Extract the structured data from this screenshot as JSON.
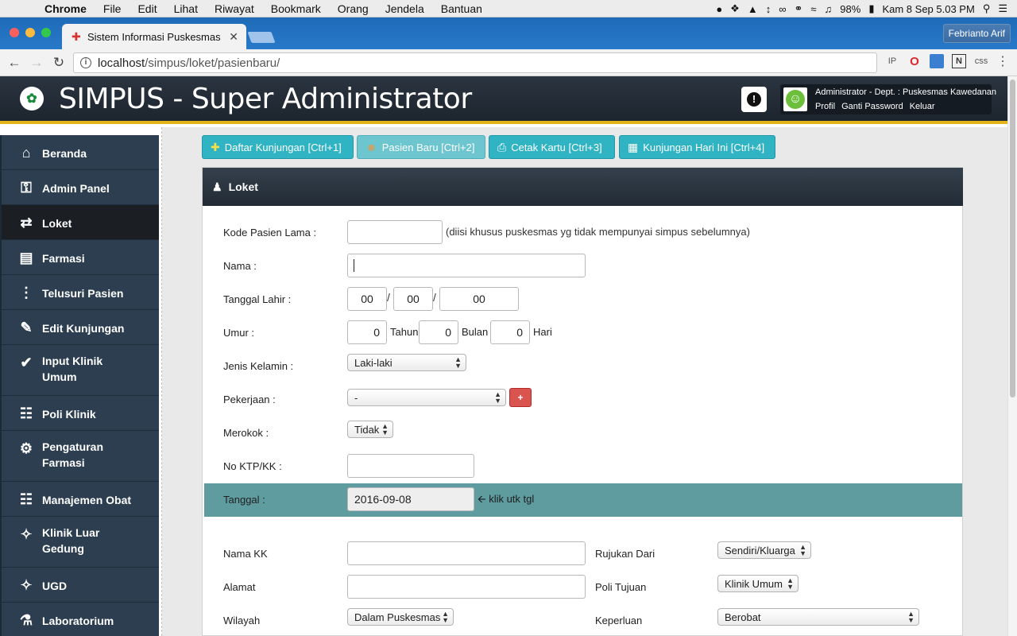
{
  "menubar": {
    "app": "Chrome",
    "items": [
      "File",
      "Edit",
      "Lihat",
      "Riwayat",
      "Bookmark",
      "Orang",
      "Jendela",
      "Bantuan"
    ],
    "battery": "98%",
    "clock": "Kam 8 Sep  5.03 PM"
  },
  "browser": {
    "tab_title": "Sistem Informasi Puskesmas",
    "profile": "Febrianto Arif",
    "url_host": "localhost",
    "url_path": "/simpus/loket/pasienbaru/",
    "ext_labels": [
      "IP",
      "css"
    ]
  },
  "header": {
    "title": "SIMPUS - Super Administrator",
    "user_line": "Administrator - Dept. : Puskesmas Kawedanan",
    "links": [
      "Profil",
      "Ganti Password",
      "Keluar"
    ]
  },
  "sidebar": {
    "items": [
      {
        "label": "Beranda",
        "icon": "home-icon"
      },
      {
        "label": "Admin Panel",
        "icon": "key-icon"
      },
      {
        "label": "Loket",
        "icon": "shuffle-icon"
      },
      {
        "label": "Farmasi",
        "icon": "clipboard-icon"
      },
      {
        "label": "Telusuri Pasien",
        "icon": "road-icon"
      },
      {
        "label": "Edit Kunjungan",
        "icon": "pencil-icon"
      },
      {
        "label": "Input Klinik Umum",
        "icon": "check-icon"
      },
      {
        "label": "Poli Klinik",
        "icon": "database-icon"
      },
      {
        "label": "Pengaturan Farmasi",
        "icon": "gear-icon"
      },
      {
        "label": "Manajemen Obat",
        "icon": "database-icon"
      },
      {
        "label": "Klinik Luar Gedung",
        "icon": "person-icon"
      },
      {
        "label": "UGD",
        "icon": "person-icon"
      },
      {
        "label": "Laboratorium",
        "icon": "flask-icon"
      }
    ],
    "active": "Loket"
  },
  "actions": {
    "daftar": "Daftar Kunjungan [Ctrl+1]",
    "pasien_baru": "Pasien Baru [Ctrl+2]",
    "cetak": "Cetak Kartu [Ctrl+3]",
    "hari_ini": "Kunjungan Hari Ini [Ctrl+4]"
  },
  "panel": {
    "title": "Loket"
  },
  "form": {
    "kode_label": "Kode Pasien Lama :",
    "kode_value": "",
    "kode_hint": "(diisi khusus puskesmas yg tidak mempunyai simpus sebelumnya)",
    "nama_label": "Nama :",
    "nama_value": "",
    "tgl_lahir_label": "Tanggal Lahir :",
    "tgl_day": "00",
    "tgl_month": "00",
    "tgl_year": "00",
    "date_sep": "/",
    "umur_label": "Umur :",
    "umur_tahun": "0",
    "umur_bulan": "0",
    "umur_hari": "0",
    "tahun": "Tahun",
    "bulan": "Bulan",
    "hari": "Hari",
    "jk_label": "Jenis Kelamin :",
    "jk_value": "Laki-laki",
    "pekerjaan_label": "Pekerjaan :",
    "pekerjaan_value": "-",
    "plus": "+",
    "merokok_label": "Merokok :",
    "merokok_value": "Tidak",
    "ktp_label": "No KTP/KK :",
    "ktp_value": "",
    "tanggal_label": "Tanggal :",
    "tanggal_value": "2016-09-08",
    "tanggal_hint": "klik utk tgl",
    "kk_label": "Nama KK",
    "kk_value": "",
    "alamat_label": "Alamat",
    "alamat_value": "",
    "wilayah_label": "Wilayah",
    "wilayah_value": "Dalam Puskesmas",
    "rujukan_label": "Rujukan Dari",
    "rujukan_value": "Sendiri/Kluarga",
    "poli_label": "Poli Tujuan",
    "poli_value": "Klinik Umum",
    "keperluan_label": "Keperluan",
    "keperluan_value": "Berobat"
  },
  "colors": {
    "header_bg": "#222b35",
    "header_accent": "#e5b41a",
    "sidebar_bg": "#2c3e50",
    "button_teal": "#30b3c3",
    "tanggal_bar": "#5e9ca0",
    "danger": "#d9534f"
  }
}
